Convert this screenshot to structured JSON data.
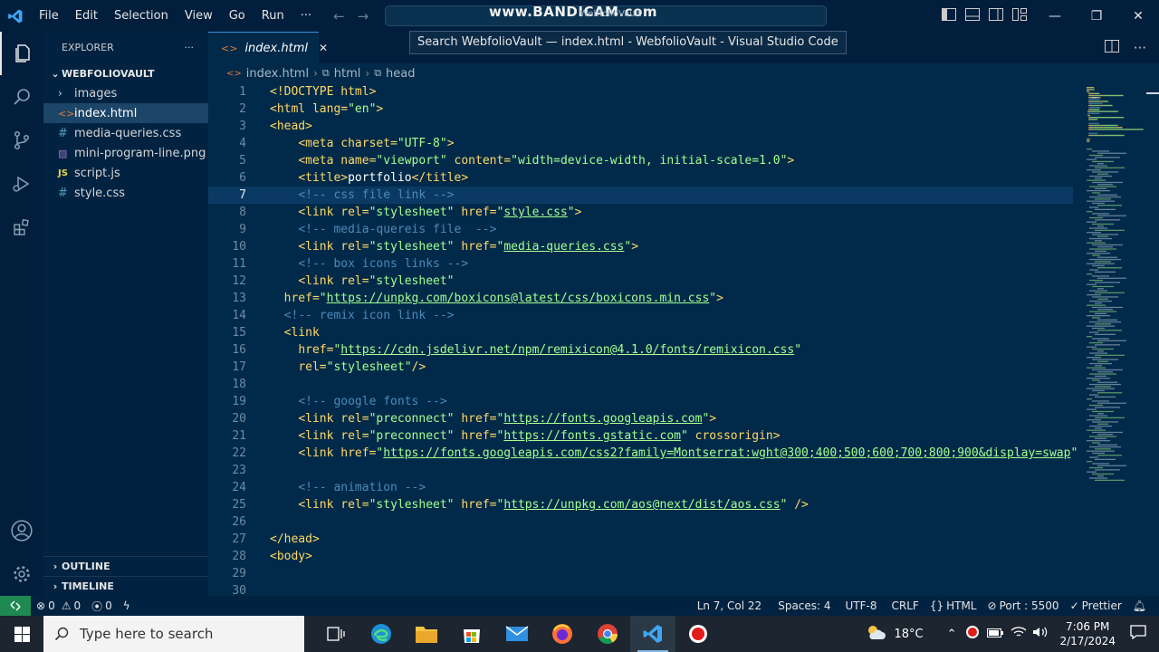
{
  "titlebar": {
    "menu": [
      "File",
      "Edit",
      "Selection",
      "View",
      "Go",
      "Run",
      "···"
    ],
    "watermark": "www.BANDICAM.com",
    "watermark_sub": "WebfolioVault",
    "tooltip": "Search WebfolioVault — index.html - WebfolioVault - Visual Studio Code"
  },
  "sidebar": {
    "header": "EXPLORER",
    "header_more": "···",
    "folder": "WEBFOLIOVAULT",
    "items": [
      {
        "label": "images",
        "icon": "chevron-right-icon"
      },
      {
        "label": "index.html",
        "icon": "html-file-icon"
      },
      {
        "label": "media-queries.css",
        "icon": "css-file-icon"
      },
      {
        "label": "mini-program-line.png",
        "icon": "image-file-icon"
      },
      {
        "label": "script.js",
        "icon": "js-file-icon"
      },
      {
        "label": "style.css",
        "icon": "css-file-icon"
      }
    ],
    "outline": "OUTLINE",
    "timeline": "TIMELINE"
  },
  "tabs": [
    {
      "label": "index.html",
      "close": "✕"
    }
  ],
  "breadcrumb": [
    "index.html",
    "html",
    "head"
  ],
  "colors": {
    "accent": "#3b8fd6",
    "remote": "#1e8a52",
    "bg": "#012a4a"
  },
  "editor": {
    "current_line": 7,
    "lines": [
      {
        "n": "1",
        "tokens": [
          [
            "tag",
            "<!DOCTYPE html>"
          ]
        ]
      },
      {
        "n": "2",
        "tokens": [
          [
            "tag",
            "<html "
          ],
          [
            "attr",
            "lang="
          ],
          [
            "str",
            "\"en\""
          ],
          [
            "tag",
            ">"
          ]
        ]
      },
      {
        "n": "3",
        "tokens": [
          [
            "tag",
            "<head>"
          ]
        ]
      },
      {
        "n": "4",
        "tokens": [
          [
            "plain",
            "    "
          ],
          [
            "tag",
            "<meta "
          ],
          [
            "attr",
            "charset="
          ],
          [
            "str",
            "\"UTF-8\""
          ],
          [
            "tag",
            ">"
          ]
        ]
      },
      {
        "n": "5",
        "tokens": [
          [
            "plain",
            "    "
          ],
          [
            "tag",
            "<meta "
          ],
          [
            "attr",
            "name="
          ],
          [
            "str",
            "\"viewport\""
          ],
          [
            "attr",
            " content="
          ],
          [
            "str",
            "\"width=device-width, initial-scale=1.0\""
          ],
          [
            "tag",
            ">"
          ]
        ]
      },
      {
        "n": "6",
        "tokens": [
          [
            "plain",
            "    "
          ],
          [
            "tag",
            "<title>"
          ],
          [
            "text",
            "portfolio"
          ],
          [
            "tag",
            "</title>"
          ]
        ]
      },
      {
        "n": "7",
        "tokens": [
          [
            "plain",
            "    "
          ],
          [
            "comm",
            "<!-- css file link -->"
          ]
        ]
      },
      {
        "n": "8",
        "tokens": [
          [
            "plain",
            "    "
          ],
          [
            "tag",
            "<link "
          ],
          [
            "attr",
            "rel="
          ],
          [
            "str",
            "\"stylesheet\""
          ],
          [
            "attr",
            " href="
          ],
          [
            "str",
            "\""
          ],
          [
            "url",
            "style.css"
          ],
          [
            "str",
            "\""
          ],
          [
            "tag",
            ">"
          ]
        ]
      },
      {
        "n": "9",
        "tokens": [
          [
            "plain",
            "    "
          ],
          [
            "comm",
            "<!-- media-quereis file  -->"
          ]
        ]
      },
      {
        "n": "10",
        "tokens": [
          [
            "plain",
            "    "
          ],
          [
            "tag",
            "<link "
          ],
          [
            "attr",
            "rel="
          ],
          [
            "str",
            "\"stylesheet\""
          ],
          [
            "attr",
            " href="
          ],
          [
            "str",
            "\""
          ],
          [
            "url",
            "media-queries.css"
          ],
          [
            "str",
            "\""
          ],
          [
            "tag",
            ">"
          ]
        ]
      },
      {
        "n": "11",
        "tokens": [
          [
            "plain",
            "    "
          ],
          [
            "comm",
            "<!-- box icons links -->"
          ]
        ]
      },
      {
        "n": "12",
        "tokens": [
          [
            "plain",
            "    "
          ],
          [
            "tag",
            "<link "
          ],
          [
            "attr",
            "rel="
          ],
          [
            "str",
            "\"stylesheet\""
          ]
        ]
      },
      {
        "n": "13",
        "tokens": [
          [
            "plain",
            "  "
          ],
          [
            "attr",
            "href="
          ],
          [
            "str",
            "\""
          ],
          [
            "url",
            "https://unpkg.com/boxicons@latest/css/boxicons.min.css"
          ],
          [
            "str",
            "\""
          ],
          [
            "tag",
            ">"
          ]
        ]
      },
      {
        "n": "14",
        "tokens": [
          [
            "plain",
            "  "
          ],
          [
            "comm",
            "<!-- remix icon link -->"
          ]
        ]
      },
      {
        "n": "15",
        "tokens": [
          [
            "plain",
            "  "
          ],
          [
            "tag",
            "<link"
          ]
        ]
      },
      {
        "n": "16",
        "tokens": [
          [
            "plain",
            "    "
          ],
          [
            "attr",
            "href="
          ],
          [
            "str",
            "\""
          ],
          [
            "url",
            "https://cdn.jsdelivr.net/npm/remixicon@4.1.0/fonts/remixicon.css"
          ],
          [
            "str",
            "\""
          ]
        ]
      },
      {
        "n": "17",
        "tokens": [
          [
            "plain",
            "    "
          ],
          [
            "attr",
            "rel="
          ],
          [
            "str",
            "\"stylesheet\""
          ],
          [
            "tag",
            "/>"
          ]
        ]
      },
      {
        "n": "18",
        "tokens": []
      },
      {
        "n": "19",
        "tokens": [
          [
            "plain",
            "    "
          ],
          [
            "comm",
            "<!-- google fonts -->"
          ]
        ]
      },
      {
        "n": "20",
        "tokens": [
          [
            "plain",
            "    "
          ],
          [
            "tag",
            "<link "
          ],
          [
            "attr",
            "rel="
          ],
          [
            "str",
            "\"preconnect\""
          ],
          [
            "attr",
            " href="
          ],
          [
            "str",
            "\""
          ],
          [
            "url",
            "https://fonts.googleapis.com"
          ],
          [
            "str",
            "\""
          ],
          [
            "tag",
            ">"
          ]
        ]
      },
      {
        "n": "21",
        "tokens": [
          [
            "plain",
            "    "
          ],
          [
            "tag",
            "<link "
          ],
          [
            "attr",
            "rel="
          ],
          [
            "str",
            "\"preconnect\""
          ],
          [
            "attr",
            " href="
          ],
          [
            "str",
            "\""
          ],
          [
            "url",
            "https://fonts.gstatic.com"
          ],
          [
            "str",
            "\""
          ],
          [
            "attr",
            " crossorigin"
          ],
          [
            "tag",
            ">"
          ]
        ]
      },
      {
        "n": "22",
        "tokens": [
          [
            "plain",
            "    "
          ],
          [
            "tag",
            "<link "
          ],
          [
            "attr",
            "href="
          ],
          [
            "str",
            "\""
          ],
          [
            "url",
            "https://fonts.googleapis.com/css2?family=Montserrat:wght@300;400;500;600;700;800;900&display=swap"
          ],
          [
            "str",
            "\""
          ]
        ]
      },
      {
        "n": "23",
        "tokens": []
      },
      {
        "n": "24",
        "tokens": [
          [
            "plain",
            "    "
          ],
          [
            "comm",
            "<!-- animation -->"
          ]
        ]
      },
      {
        "n": "25",
        "tokens": [
          [
            "plain",
            "    "
          ],
          [
            "tag",
            "<link "
          ],
          [
            "attr",
            "rel="
          ],
          [
            "str",
            "\"stylesheet\""
          ],
          [
            "attr",
            " href="
          ],
          [
            "str",
            "\""
          ],
          [
            "url",
            "https://unpkg.com/aos@next/dist/aos.css"
          ],
          [
            "str",
            "\""
          ],
          [
            "tag",
            " />"
          ]
        ]
      },
      {
        "n": "26",
        "tokens": []
      },
      {
        "n": "27",
        "tokens": [
          [
            "tag",
            "</head>"
          ]
        ]
      },
      {
        "n": "28",
        "tokens": [
          [
            "tag",
            "<body>"
          ]
        ]
      },
      {
        "n": "29",
        "tokens": []
      },
      {
        "n": "30",
        "tokens": []
      }
    ]
  },
  "statusbar": {
    "errors": "0",
    "warnings": "0",
    "ports": "0",
    "position": "Ln 7, Col 22",
    "spaces": "Spaces: 4",
    "encoding": "UTF-8",
    "eol": "CRLF",
    "language": "HTML",
    "port": "Port : 5500",
    "formatter": "Prettier"
  },
  "taskbar": {
    "search_placeholder": "Type here to search",
    "temperature": "18°C",
    "time": "7:06 PM",
    "date": "2/17/2024"
  }
}
